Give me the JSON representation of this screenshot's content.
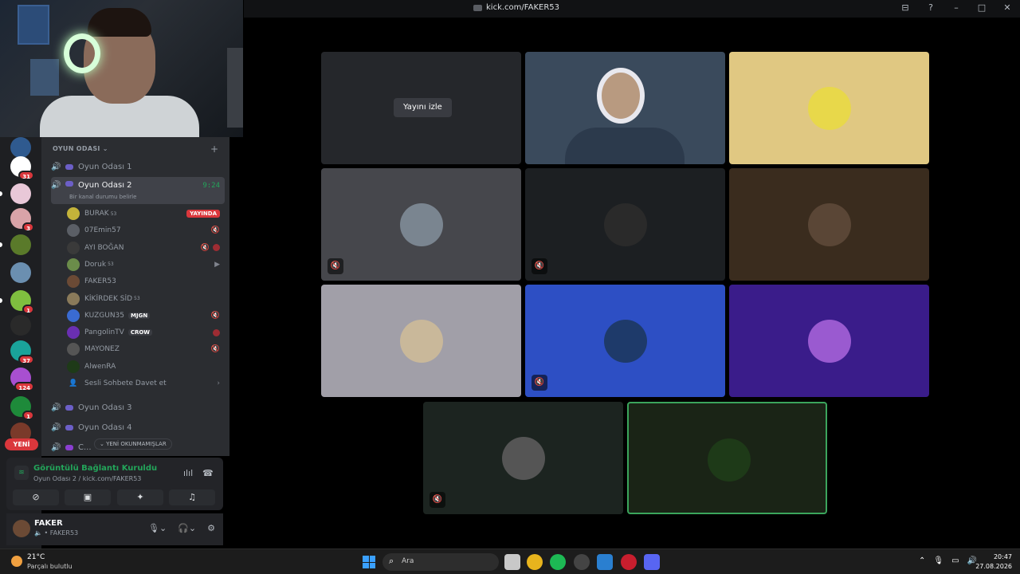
{
  "window": {
    "title": "kick.com/FAKER53",
    "controls": [
      "⊟",
      "?",
      "–",
      "□",
      "✕"
    ]
  },
  "sidebar": {
    "category": "OYUN ODASI",
    "channels_top": [
      {
        "name": "Oyun Odası 1"
      }
    ],
    "active_channel": {
      "name": "Oyun Odası 2",
      "timer": "9:24",
      "status": "Bir kanal durumu belirle"
    },
    "members": [
      {
        "name": "BURAK",
        "sup": "53",
        "badge": "YAYINDA",
        "color": "#c4b33a"
      },
      {
        "name": "07Emin57",
        "sup": "",
        "badge": "",
        "color": "#5b5f66"
      },
      {
        "name": "AYI BOĞAN",
        "sup": "",
        "badge": "",
        "color": "#3a3a3a"
      },
      {
        "name": "Doruk",
        "sup": "53",
        "badge": "",
        "color": "#6b8c4a"
      },
      {
        "name": "FAKER53",
        "sup": "",
        "badge": "",
        "color": "#6b4a35"
      },
      {
        "name": "KİKİRDEK SİD",
        "sup": "53",
        "badge": "",
        "color": "#8a7a5a"
      },
      {
        "name": "KUZGUN35",
        "sup": "",
        "badge": "",
        "tag": "MJGN",
        "color": "#3a6bd1"
      },
      {
        "name": "PangolinTV",
        "sup": "",
        "badge": "",
        "tag": "CROW",
        "color": "#6a2fb2"
      },
      {
        "name": "MAYONEZ",
        "sup": "",
        "badge": "",
        "color": "#555"
      },
      {
        "name": "AlwenRA",
        "sup": "",
        "badge": "",
        "color": "#1e3a18"
      }
    ],
    "invite": "Sesli Sohbete Davet et",
    "channels_bottom": [
      {
        "name": "Oyun Odası 3"
      },
      {
        "name": "Oyun Odası 4"
      },
      {
        "name": "C..."
      }
    ],
    "unread_label": "YENİ OKUNMAMIŞLAR",
    "new_label": "YENİ"
  },
  "servers": [
    {
      "name": "ELYRI",
      "color": "#2f5a8f",
      "badge": ""
    },
    {
      "name": "K",
      "color": "#ffffff",
      "badge": "31"
    },
    {
      "name": "pink",
      "color": "#e9c8d8",
      "badge": ""
    },
    {
      "name": "anime",
      "color": "#d9a3a8",
      "badge": "3"
    },
    {
      "name": "leaf",
      "color": "#5a7a2a",
      "badge": ""
    },
    {
      "name": "ghost",
      "color": "#6b8fb0",
      "badge": ""
    },
    {
      "name": "mc",
      "color": "#7fbf3f",
      "badge": "1"
    },
    {
      "name": "NEXUS",
      "color": "#2a2a2a",
      "badge": ""
    },
    {
      "name": "teal",
      "color": "#1aa39a",
      "badge": "37"
    },
    {
      "name": "girl",
      "color": "#a84fd0",
      "badge": "124"
    },
    {
      "name": "B",
      "color": "#1e8a3a",
      "badge": "1"
    },
    {
      "name": "red",
      "color": "#7a3a2a",
      "badge": ""
    }
  ],
  "voice_panel": {
    "status": "Görüntülü Bağlantı Kuruldu",
    "location": "Oyun Odası 2 / kick.com/FAKER53",
    "buttons": [
      "camera-off",
      "screen-share",
      "activities",
      "soundboard"
    ]
  },
  "user_panel": {
    "name": "FAKER",
    "status": "FAKER53"
  },
  "stage": {
    "watch_label": "Yayını izle",
    "tiles": [
      {
        "kind": "stream",
        "bg": "#25272b",
        "muted": false
      },
      {
        "kind": "camera",
        "bg": "#3a4a5c",
        "muted": false
      },
      {
        "kind": "avatar",
        "bg": "#e0c882",
        "avatar": "#e8d84a",
        "muted": false
      },
      {
        "kind": "avatar",
        "bg": "#46474c",
        "avatar": "#7a8590",
        "muted": true
      },
      {
        "kind": "avatar",
        "bg": "#1c1f22",
        "avatar": "#2a2a2a",
        "muted": true
      },
      {
        "kind": "avatar",
        "bg": "#3a2c1e",
        "avatar": "#5a4636",
        "muted": false
      },
      {
        "kind": "avatar",
        "bg": "#a19fa8",
        "avatar": "#c9b89a",
        "muted": false
      },
      {
        "kind": "avatar",
        "bg": "#2d4fc4",
        "avatar": "#1e3a6a",
        "muted": true
      },
      {
        "kind": "avatar",
        "bg": "#3a1c8a",
        "avatar": "#9a5ad0",
        "muted": false
      },
      {
        "kind": "avatar",
        "bg": "#1c2420",
        "avatar": "#555555",
        "muted": true
      },
      {
        "kind": "avatar",
        "bg": "#1a2416",
        "avatar": "#1e3a18",
        "muted": false,
        "speaking": true
      }
    ]
  },
  "taskbar": {
    "temp": "21°C",
    "condition": "Parçalı bulutlu",
    "search_placeholder": "Ara",
    "time": "20:47",
    "date": "27.08.2026"
  }
}
